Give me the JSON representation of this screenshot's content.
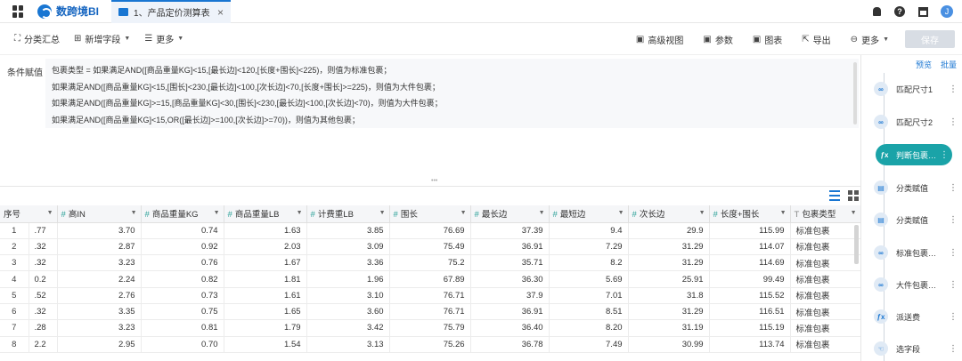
{
  "app": {
    "logo_text": "数跨境BI",
    "tab_label": "1、产品定价测算表",
    "tab_close": "×",
    "avatar_letter": "J",
    "help_glyph": "?"
  },
  "toolbar": {
    "left": [
      {
        "icon": "group-icon",
        "glyph": "⛶",
        "label": "分类汇总",
        "caret": false
      },
      {
        "icon": "add-field-icon",
        "glyph": "⊞",
        "label": "新增字段",
        "caret": true
      },
      {
        "icon": "list-icon",
        "glyph": "☰",
        "label": "更多",
        "caret": true
      }
    ],
    "right": [
      {
        "icon": "advanced-view-icon",
        "glyph": "▣",
        "label": "高级视图"
      },
      {
        "icon": "param-icon",
        "glyph": "▣",
        "label": "参数"
      },
      {
        "icon": "chart-icon",
        "glyph": "▣",
        "label": "图表"
      },
      {
        "icon": "export-icon",
        "glyph": "⇱",
        "label": "导出"
      },
      {
        "icon": "more-circle-icon",
        "glyph": "⊖",
        "label": "更多"
      }
    ],
    "save_label": "保存"
  },
  "condition": {
    "label": "条件赋值",
    "lines": [
      "包裹类型 = 如果满足AND([商品重量KG]<15,[最长边]<120,[长度+围长]<225)，则值为标准包裹；",
      "如果满足AND([商品重量KG]<15,[围长]<230,[最长边]<100,[次长边]<70,[长度+围长]>=225)，则值为大件包裹；",
      "如果满足AND([商品重量KG]>=15,[商品重量KG]<30,[围长]<230,[最长边]<100,[次长边]<70)，则值为大件包裹；",
      "如果满足AND([商品重量KG]<15,OR([最长边]>=100,[次长边]>=70))，则值为其他包裹；"
    ]
  },
  "table": {
    "columns": [
      {
        "label": "序号",
        "type": "none"
      },
      {
        "label": "高IN",
        "type": "num"
      },
      {
        "label": "商品重量KG",
        "type": "num"
      },
      {
        "label": "商品重量LB",
        "type": "num"
      },
      {
        "label": "计费重LB",
        "type": "num"
      },
      {
        "label": "围长",
        "type": "num"
      },
      {
        "label": "最长边",
        "type": "num"
      },
      {
        "label": "最短边",
        "type": "num"
      },
      {
        "label": "次长边",
        "type": "num"
      },
      {
        "label": "长度+围长",
        "type": "num"
      },
      {
        "label": "包裹类型",
        "type": "text"
      }
    ],
    "rows": [
      [
        "1",
        ".77",
        "3.70",
        "0.74",
        "1.63",
        "3.85",
        "76.69",
        "37.39",
        "9.4",
        "29.9",
        "115.99",
        "标准包裹"
      ],
      [
        "2",
        ".32",
        "2.87",
        "0.92",
        "2.03",
        "3.09",
        "75.49",
        "36.91",
        "7.29",
        "31.29",
        "114.07",
        "标准包裹"
      ],
      [
        "3",
        ".32",
        "3.23",
        "0.76",
        "1.67",
        "3.36",
        "75.2",
        "35.71",
        "8.2",
        "31.29",
        "114.69",
        "标准包裹"
      ],
      [
        "4",
        "0.2",
        "2.24",
        "0.82",
        "1.81",
        "1.96",
        "67.89",
        "36.30",
        "5.69",
        "25.91",
        "99.49",
        "标准包裹"
      ],
      [
        "5",
        ".52",
        "2.76",
        "0.73",
        "1.61",
        "3.10",
        "76.71",
        "37.9",
        "7.01",
        "31.8",
        "115.52",
        "标准包裹"
      ],
      [
        "6",
        ".32",
        "3.35",
        "0.75",
        "1.65",
        "3.60",
        "76.71",
        "36.91",
        "8.51",
        "31.29",
        "116.51",
        "标准包裹"
      ],
      [
        "7",
        ".28",
        "3.23",
        "0.81",
        "1.79",
        "3.42",
        "75.79",
        "36.40",
        "8.20",
        "31.19",
        "115.19",
        "标准包裹"
      ],
      [
        "8",
        "2.2",
        "2.95",
        "0.70",
        "1.54",
        "3.13",
        "75.26",
        "36.78",
        "7.49",
        "30.99",
        "113.74",
        "标准包裹"
      ]
    ]
  },
  "right_panel": {
    "preview_label": "预览",
    "batch_label": "批量",
    "steps": [
      {
        "label": "匹配尺寸1",
        "badge": "∞",
        "active": false
      },
      {
        "label": "匹配尺寸2",
        "badge": "∞",
        "active": false
      },
      {
        "label": "判断包裹…",
        "badge": "ƒx",
        "active": true
      },
      {
        "label": "分类赋值",
        "badge": "▤",
        "active": false
      },
      {
        "label": "分类赋值",
        "badge": "▤",
        "active": false
      },
      {
        "label": "标准包裹…",
        "badge": "∞",
        "active": false
      },
      {
        "label": "大件包裹…",
        "badge": "∞",
        "active": false
      },
      {
        "label": "派送费",
        "badge": "ƒx",
        "active": false
      },
      {
        "label": "选字段",
        "badge": "☜",
        "active": false
      }
    ]
  }
}
